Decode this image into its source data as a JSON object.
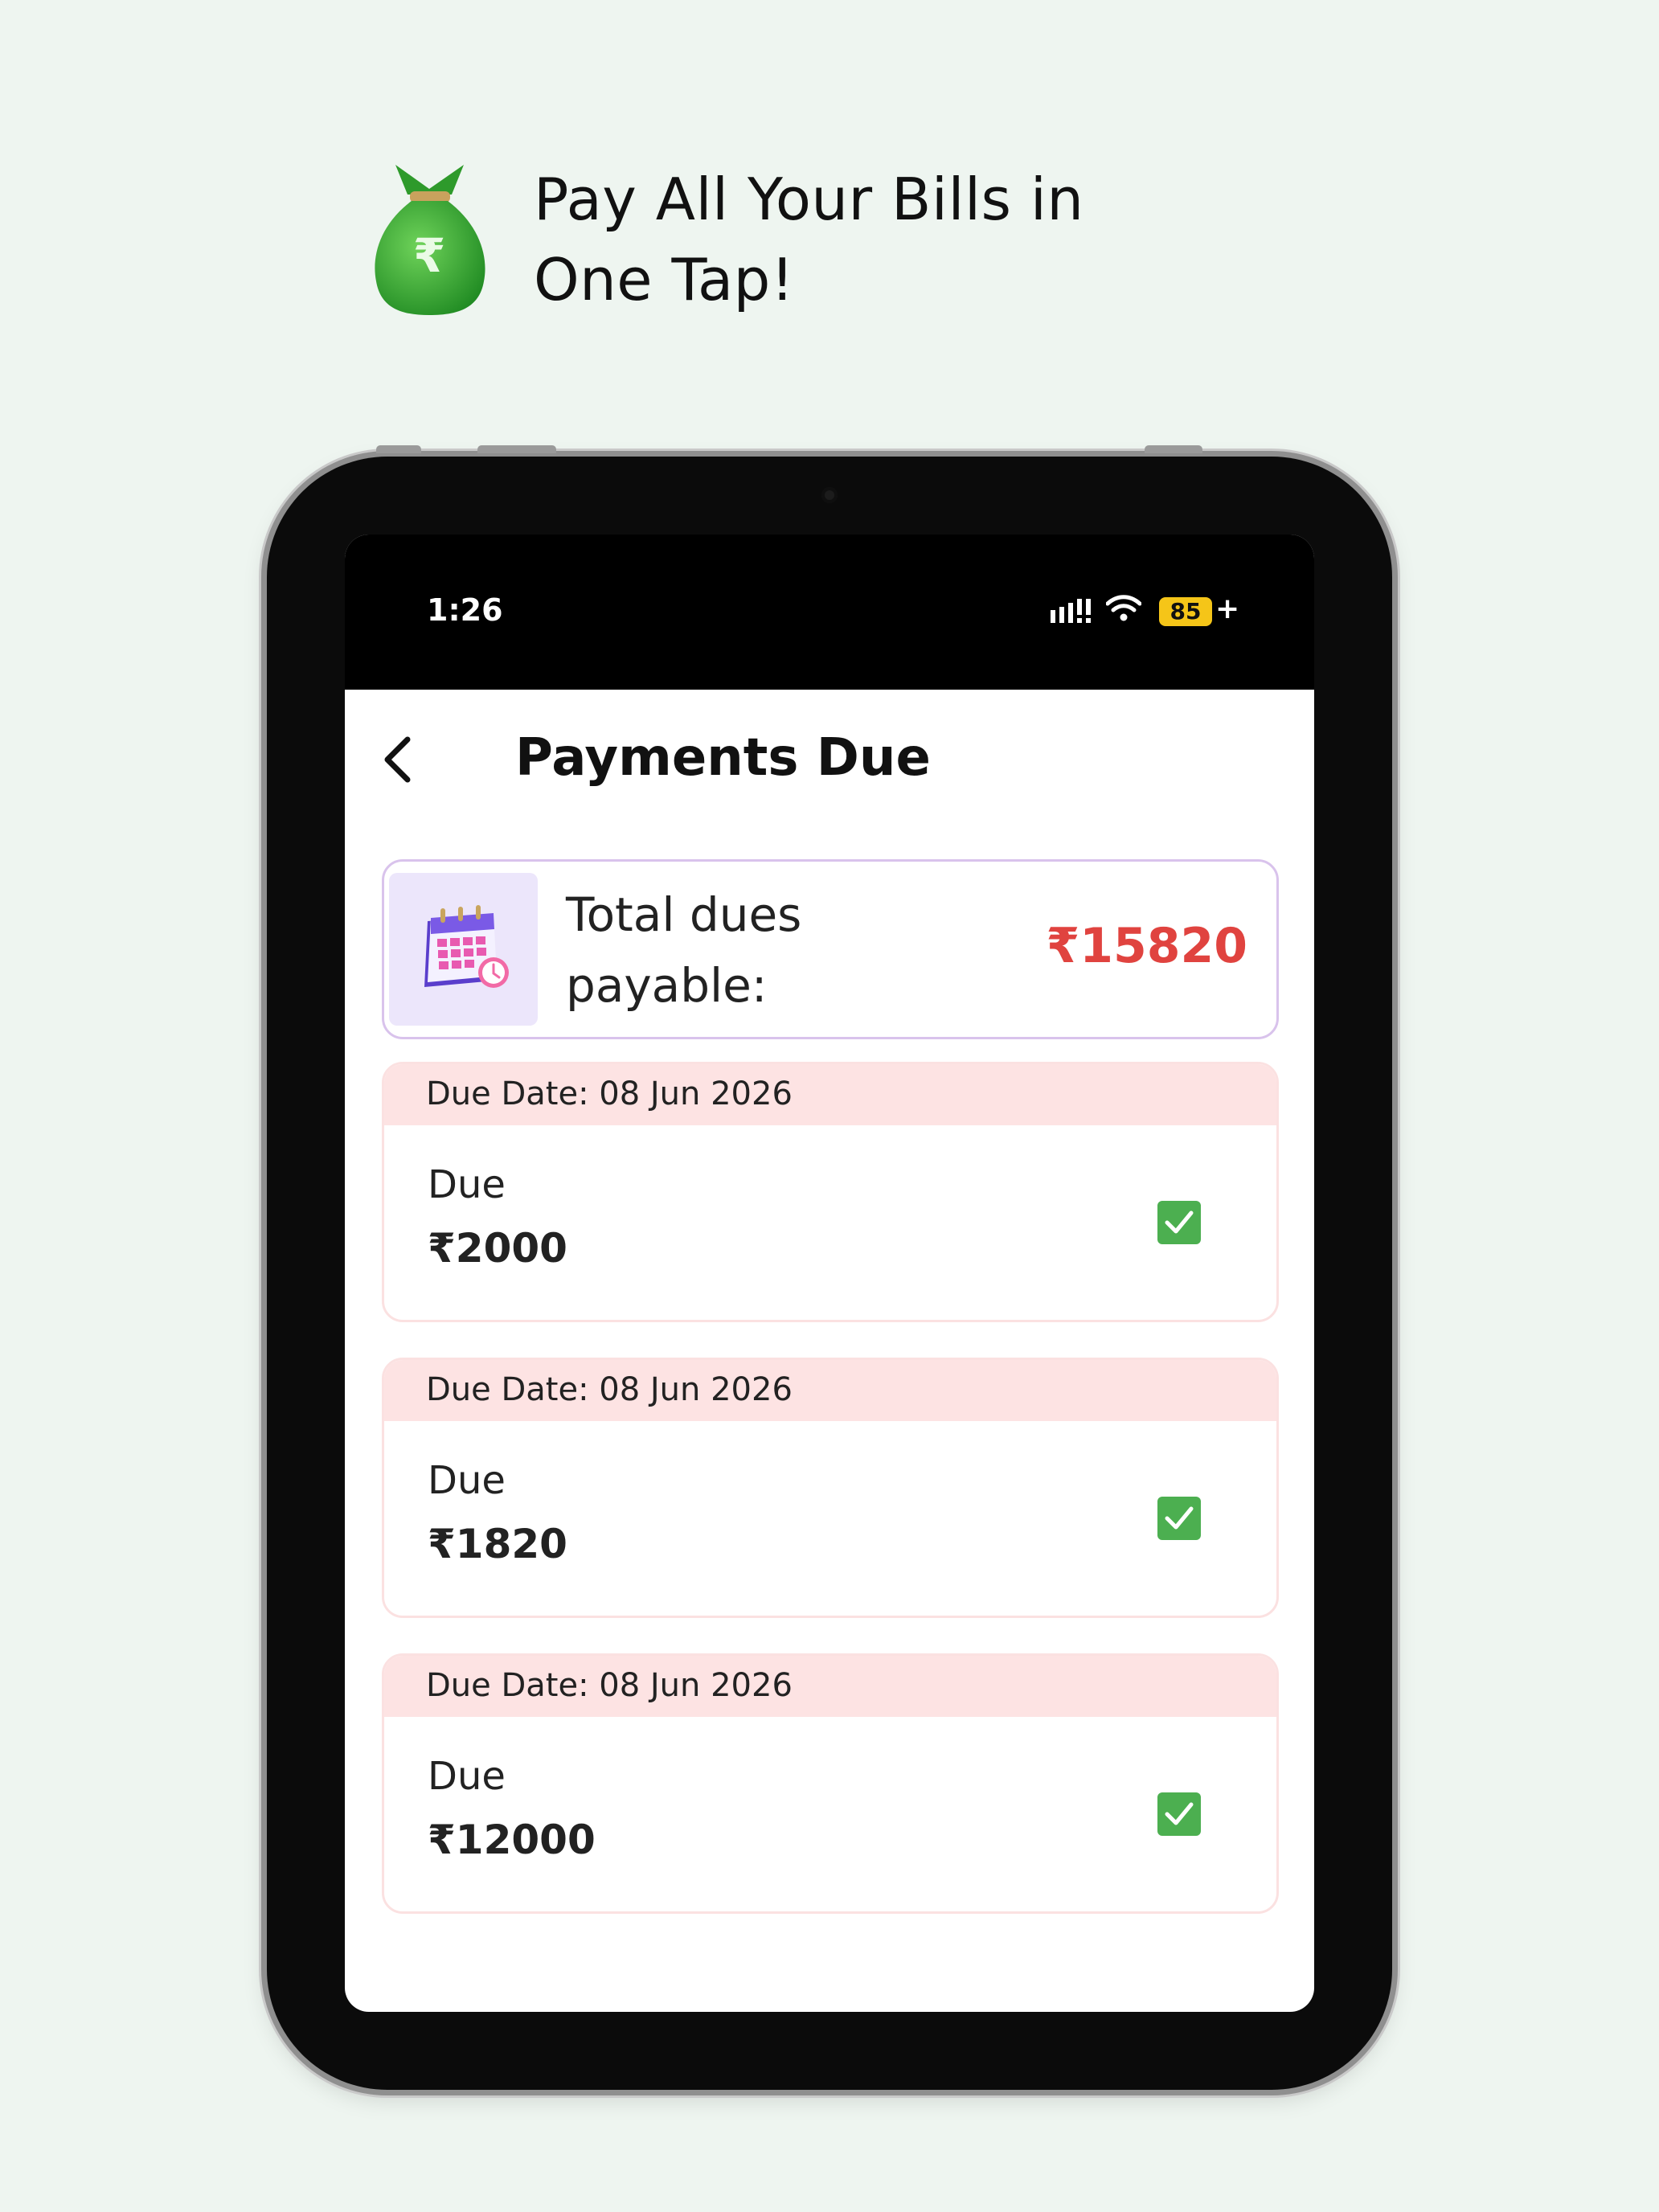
{
  "promo": {
    "line1": "Pay All Your Bills in",
    "line2": "One Tap!",
    "icon": "money-bag-rupee-icon",
    "icon_symbol": "₹"
  },
  "status_bar": {
    "time": "1:26",
    "battery": "85",
    "battery_suffix": "+",
    "icons": [
      "signal-icon",
      "wifi-icon",
      "battery-icon"
    ]
  },
  "header": {
    "back_icon": "chevron-left-icon",
    "title": "Payments Due"
  },
  "total": {
    "icon": "calendar-clock-icon",
    "label": "Total dues payable:",
    "amount": "₹15820",
    "amount_color": "#e0433f"
  },
  "dues": [
    {
      "due_date": "Due Date: 08 Jun 2026",
      "label": "Due",
      "amount": "₹2000",
      "checked": true
    },
    {
      "due_date": "Due Date: 08 Jun 2026",
      "label": "Due",
      "amount": "₹1820",
      "checked": true
    },
    {
      "due_date": "Due Date: 08 Jun 2026",
      "label": "Due",
      "amount": "₹12000",
      "checked": true
    }
  ],
  "colors": {
    "background": "#eef5f0",
    "checkbox": "#4caf50",
    "date_strip": "#fde3e3",
    "card_border_total": "#d9c3ec",
    "battery": "#f5c518"
  }
}
